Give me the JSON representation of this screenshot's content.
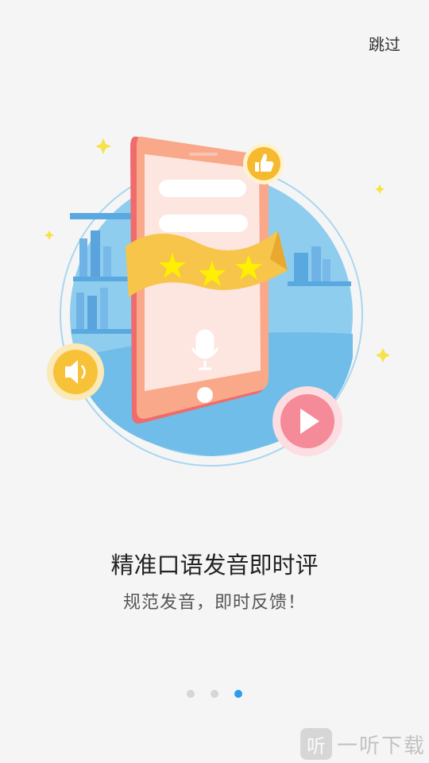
{
  "header": {
    "skip_label": "跳过"
  },
  "slide": {
    "title": "精准口语发音即时评",
    "subtitle": "规范发音，即时反馈！"
  },
  "pager": {
    "total": 3,
    "active_index": 2
  },
  "watermark": {
    "logo_glyph": "听",
    "text": "一听下载"
  },
  "colors": {
    "background": "#f5f5f5",
    "accent_blue": "#2d9cf0",
    "phone_coral": "#f7a98d",
    "ribbon_yellow": "#f6c54a",
    "play_pink": "#f58a98"
  },
  "icons": [
    "thumbs-up-icon",
    "speaker-icon",
    "play-icon",
    "microphone-icon",
    "star-icon"
  ]
}
